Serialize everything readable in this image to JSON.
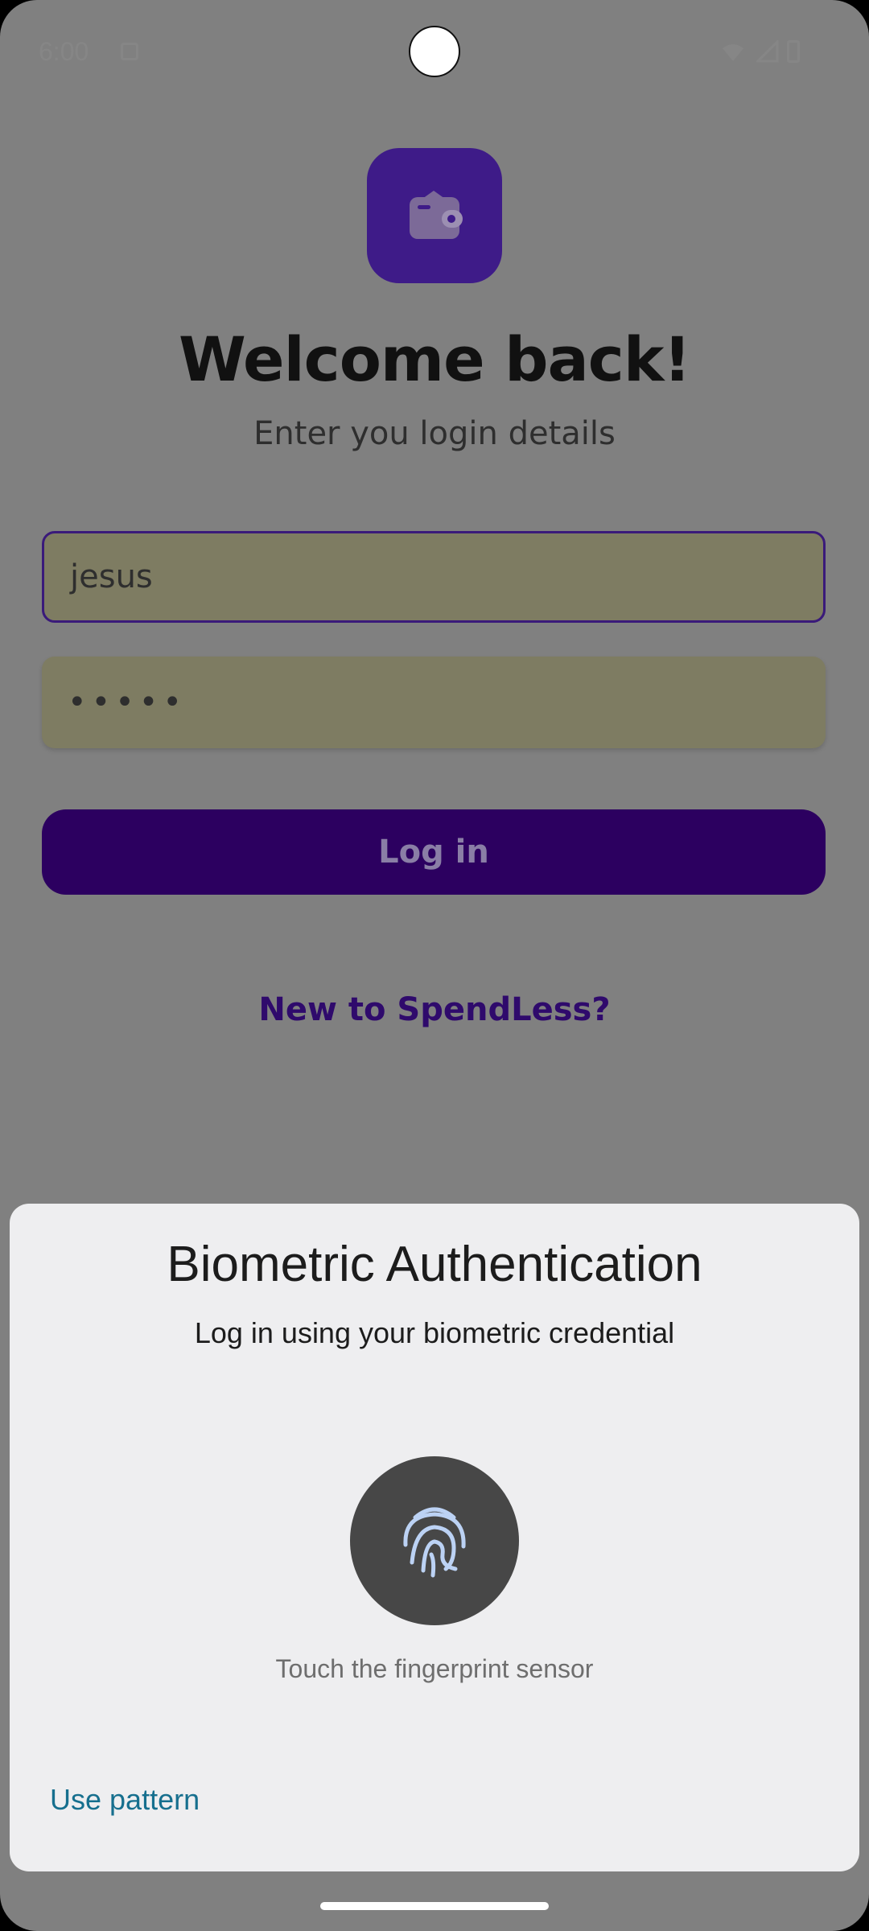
{
  "status_bar": {
    "time": "6:00"
  },
  "app": {
    "logo_icon": "wallet-icon",
    "title": "Welcome back!",
    "subtitle": "Enter you login details",
    "username_value": "jesus",
    "password_value": "•••••",
    "login_label": "Log in",
    "signup_link": "New to SpendLess?"
  },
  "biometric_dialog": {
    "title": "Biometric Authentication",
    "subtitle": "Log in using your biometric credential",
    "icon": "fingerprint-icon",
    "hint": "Touch the fingerprint sensor",
    "alternate_action": "Use pattern"
  },
  "colors": {
    "scrim": "#808080",
    "brand_primary": "#2c0060",
    "app_icon_bg": "#3e1b88",
    "field_bg": "#7e7c62",
    "sheet_bg": "#eeeef0",
    "link_teal": "#166f8e"
  }
}
